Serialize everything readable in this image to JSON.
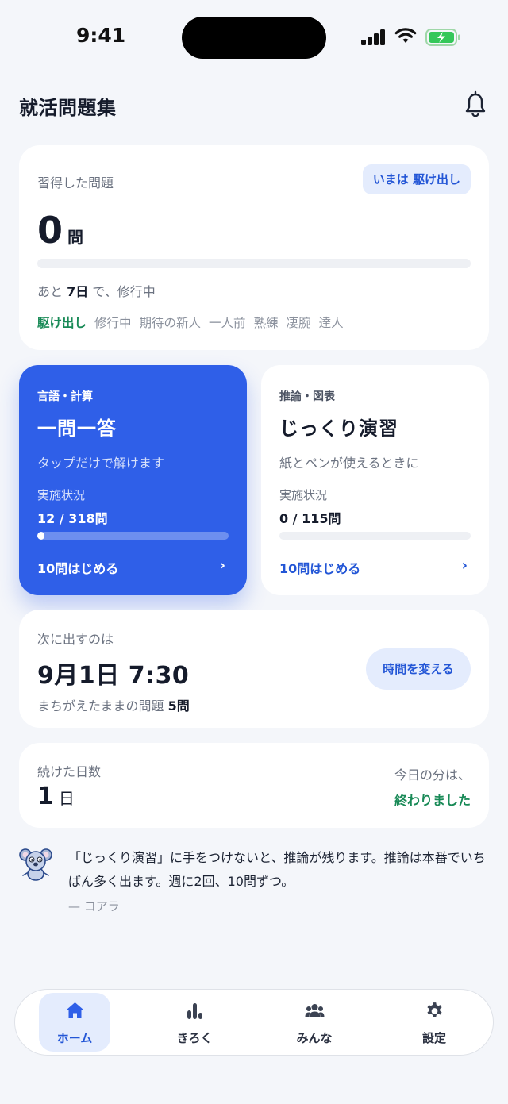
{
  "status_bar": {
    "time": "9:41"
  },
  "header": {
    "title": "就活問題集"
  },
  "learned": {
    "label": "習得した問題",
    "stage_badge": "いまは 駆け出し",
    "count": "0",
    "count_unit": "問",
    "progress_fraction": 0,
    "remain_prefix": "あと",
    "remain_days": "7日",
    "remain_suffix": "で、修行中",
    "stages": [
      "駆け出し",
      "修行中",
      "期待の新人",
      "一人前",
      "熟練",
      "凄腕",
      "達人"
    ],
    "active_stage_index": 0
  },
  "modes": [
    {
      "tag": "言語・計算",
      "title": "一問一答",
      "desc": "タップだけで解けます",
      "status_label": "実施状況",
      "status_value": "12 / 318問",
      "progress_fraction": 0.038,
      "start_label": "10問はじめる",
      "chevron": "›"
    },
    {
      "tag": "推論・図表",
      "title": "じっくり演習",
      "desc": "紙とペンが使えるときに",
      "status_label": "実施状況",
      "status_value": "0 / 115問",
      "progress_fraction": 0,
      "start_label": "10問はじめる",
      "chevron": "›"
    }
  ],
  "next": {
    "label": "次に出すのは",
    "datetime": "9月1日 7:30",
    "wrong_prefix": "まちがえたままの問題",
    "wrong_count": "5問",
    "change_time_button": "時間を変える"
  },
  "streak": {
    "label": "続けた日数",
    "count": "1",
    "unit": "日",
    "today_label": "今日の分は、",
    "today_value": "終わりました"
  },
  "tip": {
    "text": "「じっくり演習」に手をつけないと、推論が残ります。推論は本番でいちばん多く出ます。週に2回、10問ずつ。",
    "by": "— コアラ"
  },
  "nav": {
    "items": [
      {
        "label": "ホーム",
        "icon": "home-icon",
        "active": true
      },
      {
        "label": "きろく",
        "icon": "bar-chart-icon",
        "active": false
      },
      {
        "label": "みんな",
        "icon": "people-icon",
        "active": false
      },
      {
        "label": "設定",
        "icon": "gear-icon",
        "active": false
      }
    ]
  },
  "colors": {
    "accent": "#2f5fe8",
    "accent_text": "#2356d6",
    "accent_soft": "#e4ecfd",
    "success": "#198a57",
    "background": "#f4f6fa"
  }
}
